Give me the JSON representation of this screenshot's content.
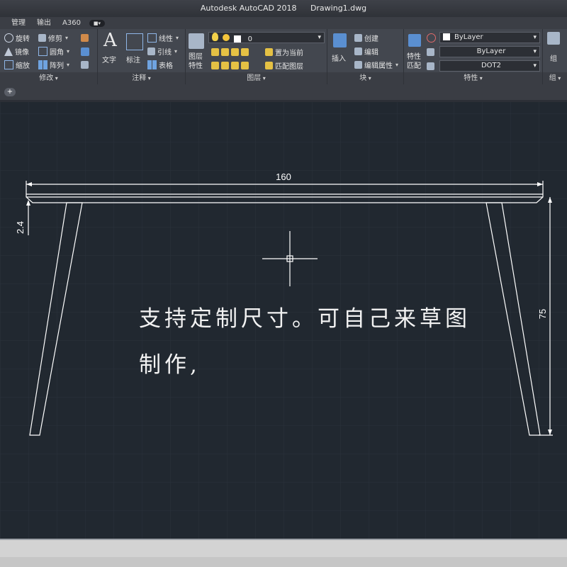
{
  "titlebar": {
    "app": "Autodesk AutoCAD 2018",
    "file": "Drawing1.dwg"
  },
  "tabs": [
    {
      "label": "管理"
    },
    {
      "label": "输出"
    },
    {
      "label": "A360"
    }
  ],
  "ribbon": {
    "modify": {
      "title": "修改",
      "items": [
        "旋转",
        "修剪",
        "镜像",
        "圆角",
        "缩放",
        "阵列"
      ]
    },
    "annotate": {
      "title": "注释",
      "text_label": "文字",
      "dim_label": "标注",
      "items": [
        "线性",
        "引线",
        "表格"
      ]
    },
    "layers": {
      "title": "图层",
      "props_label": "图层特性",
      "layer_value": "0",
      "set_current": "置为当前",
      "match_layer": "匹配图层"
    },
    "block": {
      "title": "块",
      "insert_label": "插入",
      "create": "创建",
      "edit": "编辑",
      "edit_attrs": "编辑属性"
    },
    "properties": {
      "title": "特性",
      "match_label": "特性匹配",
      "color_value": "ByLayer",
      "linetype_value": "ByLayer",
      "lineweight_value": "DOT2"
    },
    "group": {
      "title": "组",
      "label": "组"
    }
  },
  "drawing": {
    "dim_width": "160",
    "dim_thickness": "2.4",
    "dim_height": "75",
    "note_line1": "支持定制尺寸。可自己来草图",
    "note_line2": "制作,"
  },
  "colors": {
    "canvas": "#212830",
    "line": "#ffffff",
    "ribbon": "#43474f"
  }
}
